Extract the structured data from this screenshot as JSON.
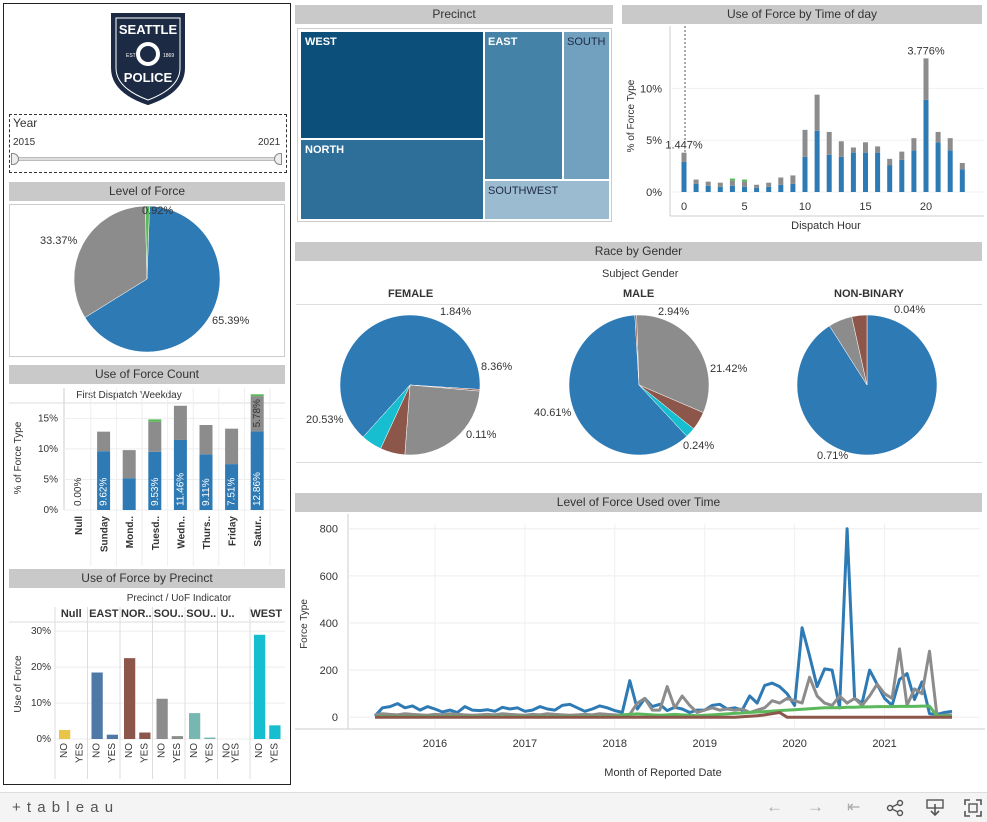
{
  "colors": {
    "blue": "#2e7ab5",
    "gray": "#8c8c8c",
    "green": "#5cb85c",
    "brown": "#8c564b",
    "cyan": "#17becf",
    "yellow": "#e8c547",
    "dark_blue_tree": "#0c4f7a"
  },
  "logo": {
    "line1": "SEATTLE",
    "line2": "POLICE",
    "est": "EST",
    "year": "1869"
  },
  "year_filter": {
    "label": "Year",
    "min": "2015",
    "max": "2021",
    "value_min": 2015,
    "value_max": 2021
  },
  "headers": {
    "level_of_force": "Level of Force",
    "use_of_force_count": "Use of Force Count",
    "use_of_force_by_precinct": "Use of Force by Precinct",
    "precinct": "Precinct",
    "use_of_force_time": "Use of Force by Time of day",
    "race_by_gender": "Race by Gender",
    "level_over_time": "Level of Force Used over Time"
  },
  "treemap_labels": {
    "west": "WEST",
    "east": "EAST",
    "south": "SOUTH",
    "north": "NORTH",
    "southwest": "SOUTHWEST"
  },
  "race_gender": {
    "subtitle": "Subject Gender",
    "female": {
      "title": "FEMALE",
      "l1": "1.84%",
      "l2": "8.36%",
      "l3": "20.53%",
      "l4": "0.11%"
    },
    "male": {
      "title": "MALE",
      "l1": "2.94%",
      "l2": "21.42%",
      "l3": "40.61%",
      "l4": "0.24%"
    },
    "nonbinary": {
      "title": "NON-BINARY",
      "l1": "0.04%",
      "l3": "0.71%"
    }
  },
  "level_pie_labels": {
    "a": "0.92%",
    "b": "33.37%",
    "c": "65.39%"
  },
  "toolbar": {
    "brand": "+ t a b l e a u"
  },
  "chart_data": [
    {
      "type": "pie",
      "title": "Level of Force",
      "slices": [
        {
          "value": 65.39,
          "color": "#2e7ab5"
        },
        {
          "value": 33.37,
          "color": "#8c8c8c"
        },
        {
          "value": 0.92,
          "color": "#5cb85c"
        }
      ]
    },
    {
      "type": "bar",
      "title": "Use of Force Count",
      "subtitle": "First Dispatch Weekday",
      "ylabel": "% of Force Type",
      "ylim": [
        0,
        18
      ],
      "yticks": [
        "0%",
        "5%",
        "10%",
        "15%"
      ],
      "categories": [
        "Null",
        "Sunday",
        "Mond..",
        "Tuesd..",
        "Wedn..",
        "Thurs..",
        "Friday",
        "Satur.."
      ],
      "series": [
        {
          "values": [
            0,
            9.62,
            5.2,
            9.53,
            11.46,
            9.11,
            7.51,
            12.86
          ]
        },
        {
          "values": [
            0,
            3.2,
            4.6,
            4.9,
            5.6,
            4.8,
            5.8,
            5.78
          ]
        },
        {
          "values": [
            0,
            0,
            0,
            0.4,
            0,
            0,
            0,
            0.3
          ]
        }
      ],
      "data_labels": [
        "0.00%",
        "9.62%",
        "",
        "9.53%",
        "11.46%",
        "9.11%",
        "7.51%",
        "12.86%"
      ],
      "top_label": "5.78%"
    },
    {
      "type": "bar",
      "title": "Use of Force by Precinct",
      "subtitle": "Precinct / UoF Indicator",
      "ylabel": "Use of Force",
      "ylim": [
        0,
        32
      ],
      "yticks": [
        "0%",
        "10%",
        "20%",
        "30%"
      ],
      "groups": [
        "Null",
        "EAST",
        "NOR..",
        "SOU..",
        "SOU..",
        "U..",
        "WEST"
      ],
      "categories": [
        "NO",
        "YES"
      ],
      "values": [
        [
          2.5,
          0
        ],
        [
          18.5,
          1.2
        ],
        [
          22.5,
          1.8
        ],
        [
          11.2,
          0.8
        ],
        [
          7.2,
          0.4
        ],
        [
          0,
          0
        ],
        [
          29,
          3.8
        ]
      ],
      "colors": [
        "#e8c547",
        "#4e79a7",
        "#8c564b",
        "#8c8c8c",
        "#76b7b2",
        "#2e7ab5",
        "#17becf"
      ]
    },
    {
      "type": "treemap",
      "title": "Precinct",
      "items": [
        "WEST",
        "EAST",
        "SOUTH",
        "NORTH",
        "SOUTHWEST"
      ]
    },
    {
      "type": "bar",
      "title": "Use of Force by Time of day",
      "xlabel": "Dispatch Hour",
      "ylabel": "% of Force Type",
      "ylim": [
        0,
        14
      ],
      "xticks": [
        "0",
        "5",
        "10",
        "15",
        "20"
      ],
      "yticks": [
        "0%",
        "5%",
        "10%"
      ],
      "x": [
        0,
        1,
        2,
        3,
        4,
        5,
        6,
        7,
        8,
        9,
        10,
        11,
        12,
        13,
        14,
        15,
        16,
        17,
        18,
        19,
        20,
        21,
        22,
        23
      ],
      "series": [
        {
          "values": [
            2.9,
            0.8,
            0.6,
            0.5,
            0.6,
            0.5,
            0.4,
            0.5,
            0.7,
            0.8,
            3.4,
            5.9,
            3.6,
            3.4,
            3.8,
            3.8,
            3.8,
            2.6,
            3.1,
            4.0,
            8.9,
            4.8,
            4.0,
            2.2
          ]
        },
        {
          "values": [
            0.9,
            0.4,
            0.4,
            0.4,
            0.5,
            0.5,
            0.3,
            0.4,
            0.7,
            0.8,
            2.6,
            3.5,
            2.2,
            1.5,
            0.5,
            1.0,
            0.6,
            0.6,
            0.8,
            1.2,
            4.0,
            1.0,
            1.2,
            0.6
          ]
        },
        {
          "values": [
            0,
            0,
            0,
            0,
            0.2,
            0.2,
            0,
            0,
            0,
            0,
            0,
            0,
            0,
            0,
            0,
            0,
            0,
            0,
            0,
            0,
            0,
            0,
            0,
            0
          ]
        }
      ],
      "data_labels": [
        {
          "x": 0,
          "label": "1.447%"
        },
        {
          "x": 20,
          "label": "3.776%"
        }
      ]
    },
    {
      "type": "pie",
      "title": "Race by Gender - FEMALE",
      "slices": [
        {
          "value": 67.5,
          "color": "#2e7ab5"
        },
        {
          "value": 0.4,
          "color": "#8c564b"
        },
        {
          "value": 26.0,
          "color": "#8c8c8c"
        },
        {
          "value": 6.0,
          "color": "#8c564b"
        },
        {
          "value": 5.0,
          "color": "#17becf"
        }
      ]
    },
    {
      "type": "pie",
      "title": "Race by Gender - MALE",
      "slices": [
        {
          "value": 61.0,
          "color": "#2e7ab5"
        },
        {
          "value": 0.4,
          "color": "#8c564b"
        },
        {
          "value": 32.0,
          "color": "#8c8c8c"
        },
        {
          "value": 4.3,
          "color": "#8c564b"
        },
        {
          "value": 2.3,
          "color": "#17becf"
        }
      ]
    },
    {
      "type": "pie",
      "title": "Race by Gender - NON-BINARY",
      "slices": [
        {
          "value": 91.0,
          "color": "#2e7ab5"
        },
        {
          "value": 5.5,
          "color": "#8c8c8c"
        },
        {
          "value": 3.5,
          "color": "#8c564b"
        }
      ]
    },
    {
      "type": "line",
      "title": "Level of Force Used over Time",
      "xlabel": "Month of Reported Date",
      "ylabel": "Force Type",
      "ylim": [
        -50,
        820
      ],
      "yticks": [
        "0",
        "200",
        "400",
        "600",
        "800"
      ],
      "xticks": [
        "2016",
        "2017",
        "2018",
        "2019",
        "2020",
        "2021"
      ],
      "x_start": "2015-05",
      "series": [
        {
          "color": "#2e7ab5",
          "values": [
            5,
            40,
            45,
            58,
            40,
            48,
            30,
            45,
            35,
            22,
            30,
            20,
            45,
            30,
            28,
            32,
            25,
            42,
            35,
            40,
            25,
            30,
            45,
            35,
            30,
            50,
            55,
            40,
            25,
            35,
            48,
            40,
            28,
            20,
            155,
            35,
            80,
            45,
            55,
            28,
            42,
            35,
            20,
            30,
            30,
            50,
            55,
            35,
            40,
            30,
            90,
            60,
            135,
            145,
            130,
            100,
            50,
            380,
            260,
            130,
            205,
            200,
            40,
            800,
            80,
            60,
            200,
            140,
            80,
            50,
            160,
            185,
            75,
            150,
            15,
            12,
            20,
            25
          ]
        },
        {
          "color": "#8c8c8c",
          "values": [
            10,
            15,
            12,
            10,
            15,
            12,
            10,
            8,
            12,
            10,
            15,
            12,
            10,
            8,
            10,
            12,
            10,
            15,
            12,
            10,
            8,
            12,
            10,
            15,
            12,
            10,
            8,
            10,
            12,
            10,
            15,
            12,
            10,
            8,
            12,
            60,
            80,
            30,
            30,
            130,
            40,
            90,
            50,
            20,
            30,
            40,
            30,
            35,
            30,
            35,
            20,
            30,
            40,
            70,
            60,
            80,
            70,
            60,
            170,
            90,
            60,
            50,
            90,
            60,
            80,
            50,
            90,
            140,
            100,
            80,
            290,
            50,
            120,
            100,
            280,
            5,
            8,
            10
          ]
        },
        {
          "color": "#5cb85c",
          "values": [
            2,
            3,
            2,
            2,
            3,
            2,
            2,
            3,
            2,
            2,
            3,
            2,
            2,
            3,
            2,
            2,
            3,
            2,
            2,
            3,
            2,
            2,
            3,
            2,
            2,
            3,
            2,
            2,
            3,
            2,
            2,
            3,
            2,
            10,
            12,
            14,
            12,
            10,
            8,
            10,
            12,
            10,
            8,
            6,
            8,
            10,
            12,
            14,
            16,
            18,
            20,
            22,
            24,
            26,
            28,
            30,
            32,
            34,
            36,
            38,
            40,
            40,
            40,
            42,
            42,
            44,
            44,
            45,
            45,
            45,
            46,
            46,
            46,
            47,
            47,
            5,
            5,
            5
          ]
        },
        {
          "color": "#8c564b",
          "values": [
            0,
            0,
            0,
            0,
            0,
            0,
            0,
            0,
            0,
            0,
            0,
            0,
            0,
            0,
            0,
            0,
            0,
            0,
            0,
            0,
            0,
            0,
            0,
            0,
            0,
            0,
            0,
            0,
            0,
            0,
            0,
            0,
            0,
            0,
            0,
            0,
            0,
            0,
            0,
            0,
            0,
            0,
            0,
            0,
            0,
            0,
            0,
            0,
            0,
            2,
            4,
            6,
            10,
            15,
            20,
            0,
            0,
            0,
            0,
            0,
            0,
            0,
            0,
            0,
            0,
            0,
            0,
            0,
            0,
            0,
            0,
            0,
            0,
            0,
            0,
            0,
            0,
            0
          ]
        }
      ]
    }
  ]
}
